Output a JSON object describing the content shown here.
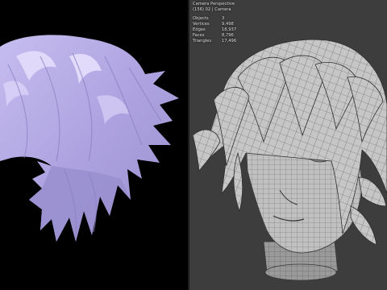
{
  "viewport": {
    "header": "Camera Perspective",
    "subheader": "(156) 02 | Camera",
    "stats": [
      {
        "label": "Objects",
        "value": "3"
      },
      {
        "label": "Vertices",
        "value": "9,498"
      },
      {
        "label": "Edges",
        "value": "18,937"
      },
      {
        "label": "Faces",
        "value": "8,796"
      },
      {
        "label": "Triangles",
        "value": "17,496"
      }
    ]
  },
  "colors": {
    "hair_render": "#b1a7e0",
    "hair_highlight": "#e3dcfb",
    "hair_shadow": "#8a80c0",
    "viewport_bg": "#3d3d3d",
    "mesh_fill": "#bdbdbd",
    "wire": "#5a5a5a",
    "render_bg": "#000000"
  },
  "icons": {
    "render_view": "rendered-hair-view",
    "wire_view": "wireframe-head-view"
  }
}
